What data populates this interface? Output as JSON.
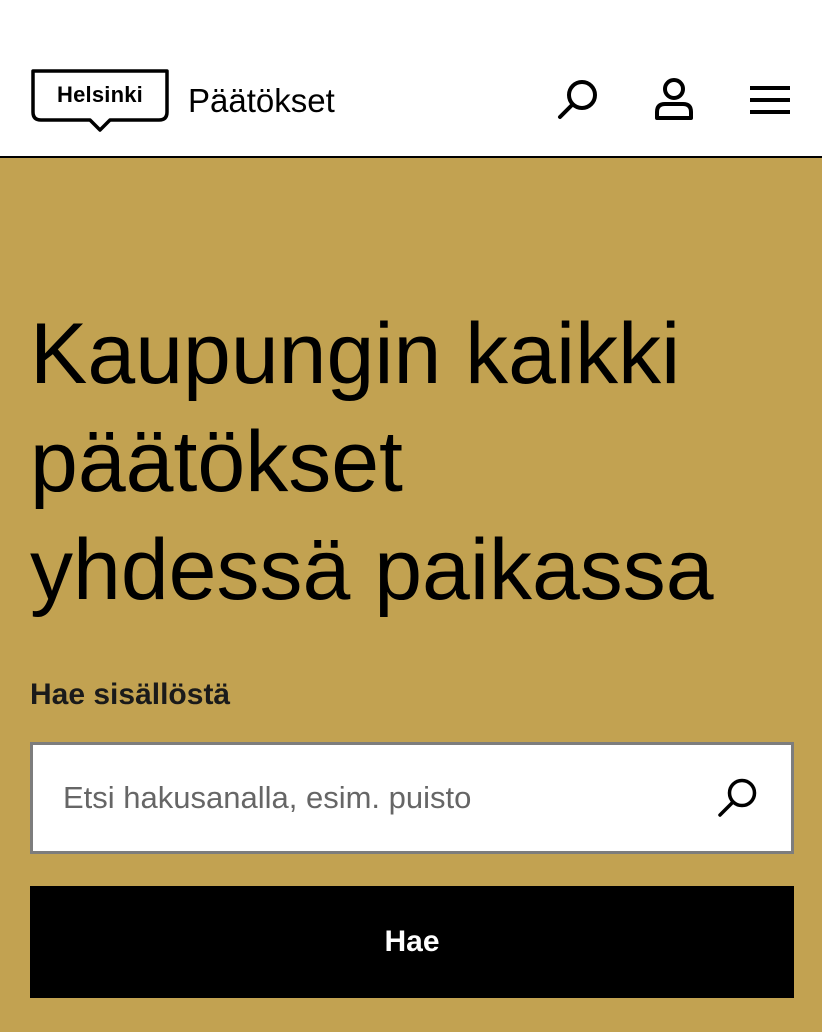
{
  "header": {
    "logo_text": "Helsinki",
    "site_name": "Päätökset",
    "icons": [
      "search-icon",
      "user-icon",
      "menu-icon"
    ]
  },
  "hero": {
    "title_lines": [
      "Kaupungin kaikki",
      "päätökset",
      "yhdessä paikassa"
    ],
    "search_label": "Hae sisällöstä",
    "search_placeholder": "Etsi hakusanalla, esim. puisto",
    "search_value": "",
    "submit_label": "Hae"
  },
  "colors": {
    "hero_background": "#c2a251",
    "header_background": "#ffffff",
    "button_background": "#000000",
    "button_text": "#ffffff"
  }
}
